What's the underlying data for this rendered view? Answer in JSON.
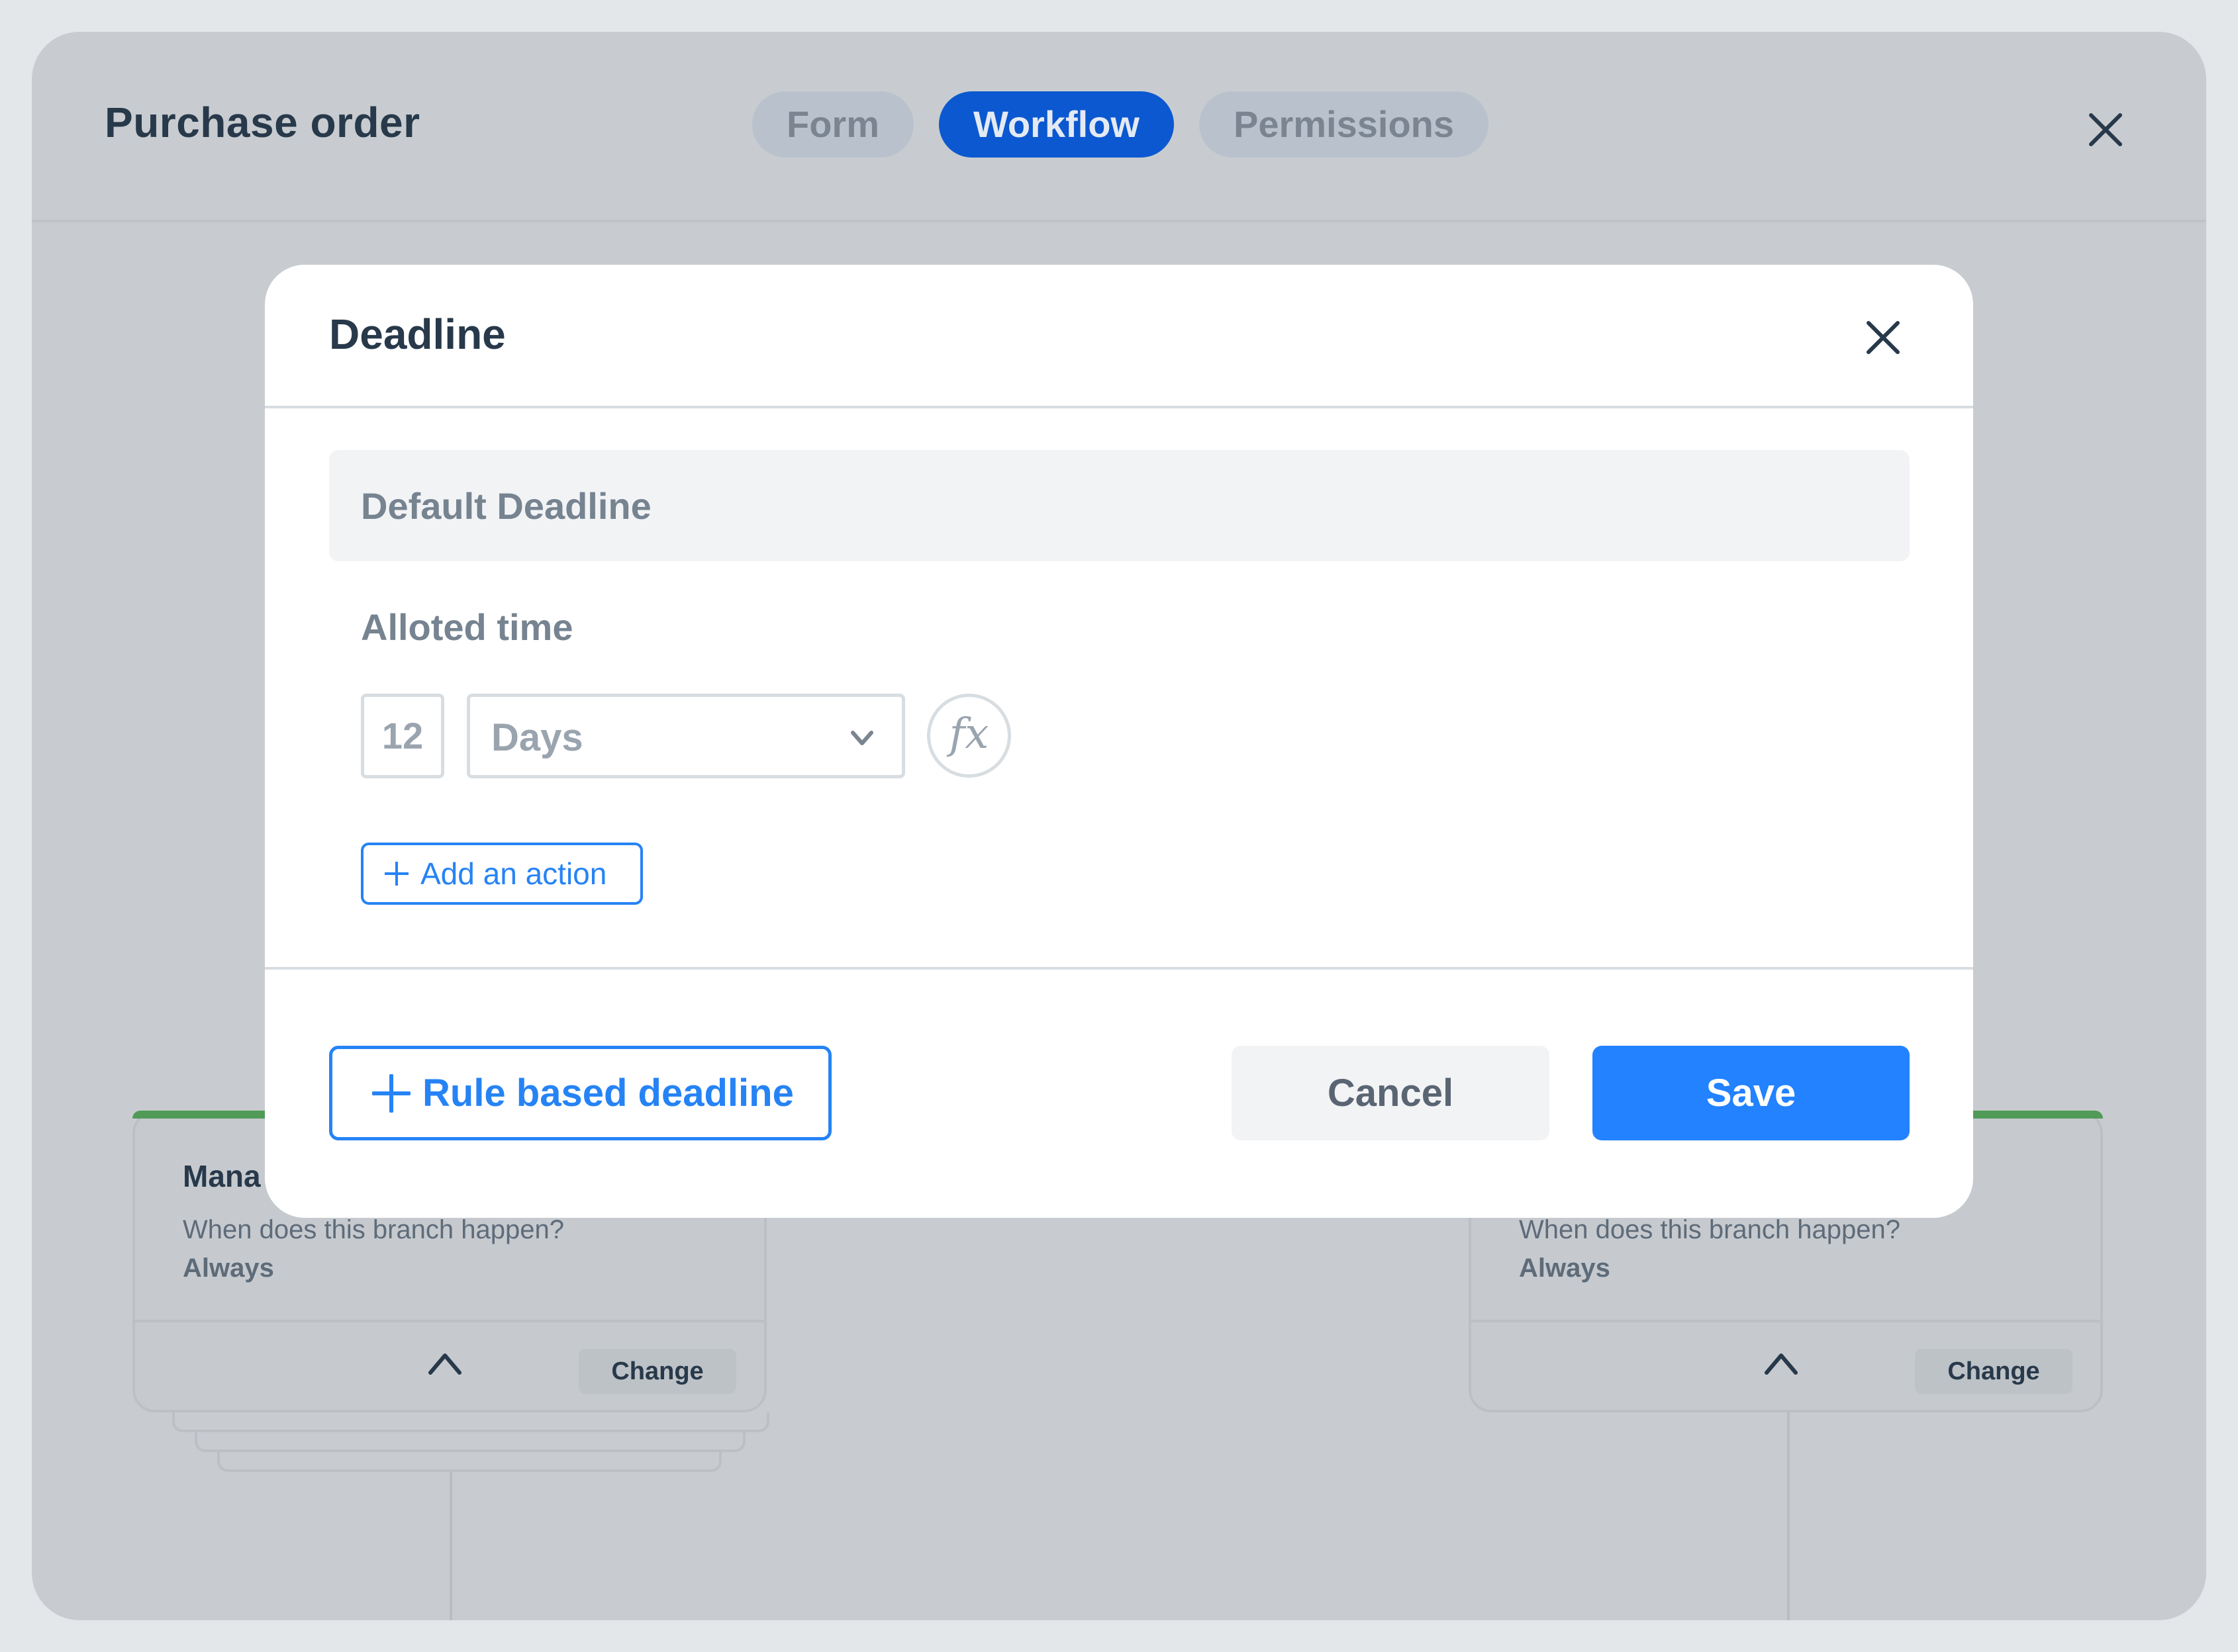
{
  "app": {
    "title": "Purchase order",
    "tabs": [
      {
        "label": "Form",
        "active": false
      },
      {
        "label": "Workflow",
        "active": true
      },
      {
        "label": "Permissions",
        "active": false
      }
    ],
    "close_icon": "close-icon"
  },
  "background_cards": [
    {
      "title": "Mana",
      "question": "When does this branch happen?",
      "answer": "Always",
      "change_label": "Change",
      "toggle_icon": "chevron-up-icon"
    },
    {
      "title": "",
      "question": "When does this branch happen?",
      "answer": "Always",
      "change_label": "Change",
      "toggle_icon": "chevron-up-icon"
    }
  ],
  "modal": {
    "title": "Deadline",
    "close_icon": "close-icon",
    "section_title": "Default Deadline",
    "alloted_time_label": "Alloted time",
    "amount_value": "12",
    "unit_selected": "Days",
    "formula_label": "fx",
    "add_action_label": "Add an action",
    "rule_based_label": "Rule based deadline",
    "cancel_label": "Cancel",
    "save_label": "Save"
  },
  "colors": {
    "accent": "#2683F5",
    "primary_button": "#2282FF",
    "active_tab": "#0B58D0",
    "card_status": "#519A57",
    "text_dark": "#27394A"
  }
}
